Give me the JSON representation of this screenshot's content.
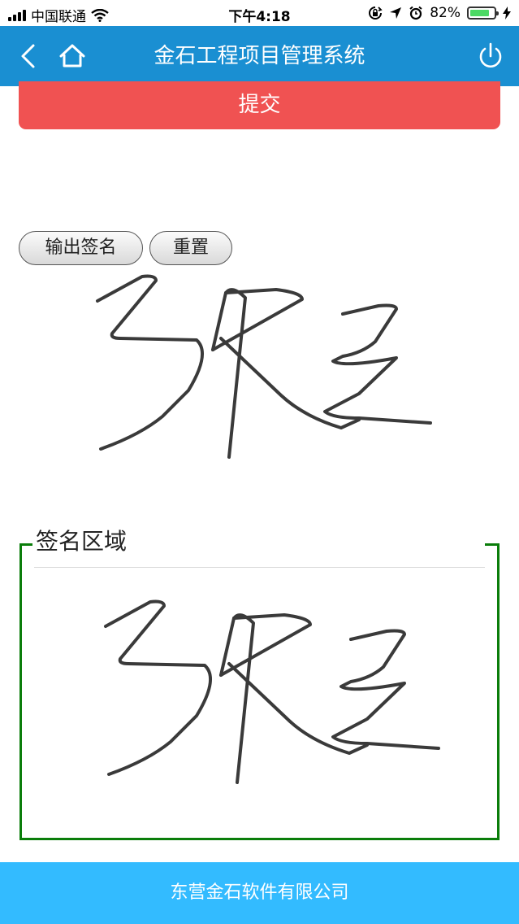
{
  "status_bar": {
    "carrier": "中国联通",
    "time": "下午4:18",
    "battery_percent": "82%",
    "battery_level": 0.82,
    "icons": [
      "signal-bars-icon",
      "wifi-icon",
      "orientation-lock-icon",
      "location-arrow-icon",
      "alarm-clock-icon",
      "battery-icon",
      "charging-bolt-icon"
    ]
  },
  "header": {
    "title": "金石工程项目管理系统",
    "icons": [
      "back-chevron-icon",
      "home-icon",
      "power-icon"
    ],
    "background": "#1a8fd2"
  },
  "form": {
    "submit_label": "提交",
    "submit_color": "#f05252"
  },
  "signature_tools": {
    "export_label": "输出签名",
    "reset_label": "重置"
  },
  "signature_area": {
    "legend": "签名区域",
    "border_color": "#0a7d0a"
  },
  "footer": {
    "company": "东营金石软件有限公司",
    "background": "#33bbff"
  }
}
